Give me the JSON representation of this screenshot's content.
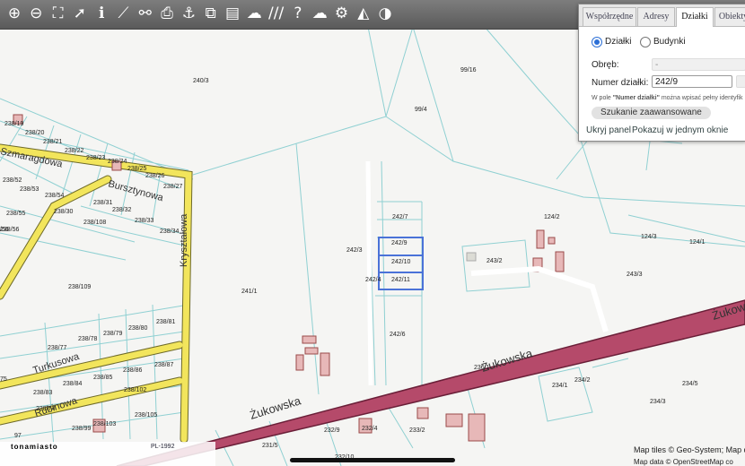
{
  "toolbar": {
    "tools": [
      {
        "name": "zoom-in-icon",
        "glyph": "⊕"
      },
      {
        "name": "zoom-out-icon",
        "glyph": "⊖"
      },
      {
        "name": "zoom-extent-icon",
        "glyph": "⛶"
      },
      {
        "name": "pointer-icon",
        "glyph": "➚"
      },
      {
        "name": "info-icon",
        "glyph": "ℹ"
      },
      {
        "name": "measure-icon",
        "glyph": "⟋"
      },
      {
        "name": "link-icon",
        "glyph": "⚯"
      },
      {
        "name": "print-icon",
        "glyph": "⎙"
      },
      {
        "name": "anchor-icon",
        "glyph": "⚓"
      },
      {
        "name": "layers-icon",
        "glyph": "⧉"
      },
      {
        "name": "layout-icon",
        "glyph": "▤"
      },
      {
        "name": "comment-icon",
        "glyph": "☁"
      },
      {
        "name": "hatch-icon",
        "glyph": "///"
      },
      {
        "name": "help-icon",
        "glyph": "?"
      },
      {
        "name": "upload-icon",
        "glyph": "☁"
      },
      {
        "name": "settings-icon",
        "glyph": "⚙"
      },
      {
        "name": "terrain-icon",
        "glyph": "◭"
      },
      {
        "name": "toggle-icon",
        "glyph": "◑"
      }
    ]
  },
  "panel": {
    "tabs": [
      "Współrzędne",
      "Adresy",
      "Działki",
      "Obiekty"
    ],
    "active_tab": "Działki",
    "radio_parcels": "Działki",
    "radio_buildings": "Budynki",
    "precinct_label": "Obręb:",
    "precinct_value": "-",
    "parcel_label": "Numer działki:",
    "parcel_value": "242/9",
    "hint_prefix": "W pole ",
    "hint_bold": "\"Numer działki\"",
    "hint_suffix": " można wpisać pełny identyfik",
    "advanced_search": "Szukanie zaawansowane",
    "hide_panel": "Ukryj panel",
    "show_one_window": "Pokazuj w jednym oknie"
  },
  "map": {
    "streets": [
      "Żukowska",
      "Żukowska",
      "Żukowska",
      "Kryształowa",
      "Bursztynowa",
      "Szmaragdowa",
      "Turkusowa",
      "Rubinowa"
    ],
    "parcels": [
      "240/3",
      "99/16",
      "99/4",
      "238/19",
      "238/20",
      "238/21",
      "238/22",
      "238/23",
      "238/24",
      "238/25",
      "238/26",
      "238/27",
      "238/52",
      "238/53",
      "238/54",
      "238/31",
      "238/30",
      "238/32",
      "238/55",
      "238/108",
      "238/33",
      "238/34",
      "238/56",
      "242/7",
      "242/9",
      "242/10",
      "242/11",
      "242/3",
      "242/4",
      "241/1",
      "238/109",
      "243/2",
      "243/3",
      "124/2",
      "124/3",
      "124/1",
      "238/81",
      "238/80",
      "238/79",
      "238/78",
      "238/77",
      "238/87",
      "238/86",
      "238/85",
      "238/84",
      "238/83",
      "238/102",
      "238/105",
      "238/74",
      "238/103",
      "238/99",
      "242/6",
      "236/1",
      "234/1",
      "234/2",
      "234/3",
      "234/5",
      "232/9",
      "232/4",
      "233/2",
      "231/5",
      "232/10",
      "75",
      "97",
      "/56"
    ],
    "selected_parcels": [
      "242/9",
      "242/10",
      "242/11"
    ],
    "scale_label": "PL-1992",
    "logo_text": "tonamiasto"
  },
  "attribution": {
    "line1": "Map tiles © Geo-System; Map d",
    "line2": "Map data © OpenStreetMap co"
  },
  "colors": {
    "road_fill": "#b54a6a",
    "road_outline": "#6a1f38",
    "street_yellow": "#f2e55c",
    "parcel_line": "#8fd0d2",
    "selected_parcel": "#4a72d8",
    "building": "#e7b8b8"
  }
}
